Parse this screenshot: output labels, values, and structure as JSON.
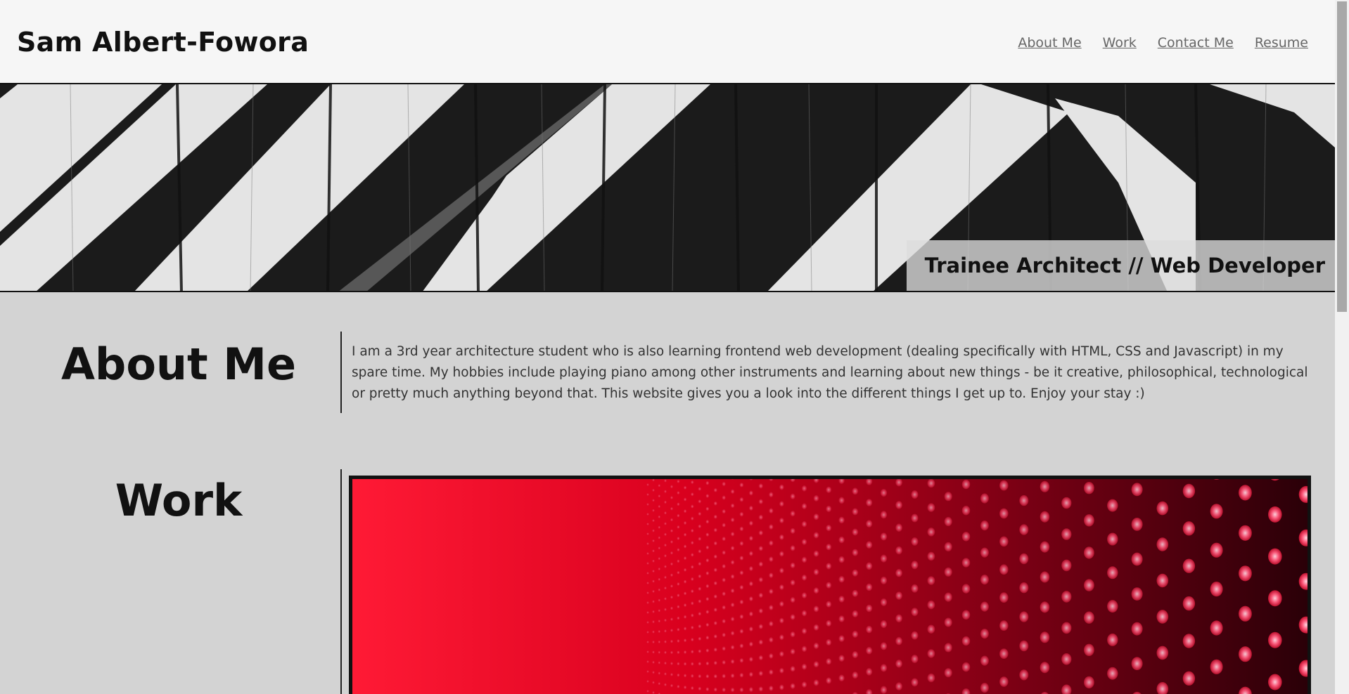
{
  "header": {
    "site_title": "Sam Albert-Fowora",
    "nav": [
      {
        "label": "About Me"
      },
      {
        "label": "Work"
      },
      {
        "label": "Contact Me"
      },
      {
        "label": "Resume"
      }
    ]
  },
  "hero": {
    "tagline": "Trainee Architect // Web Developer",
    "image": "black-white-striped-wooden-fence"
  },
  "about": {
    "heading": "About Me",
    "body": "I am a 3rd year architecture student who is also learning frontend web development (dealing specifically with HTML, CSS and Javascript) in my spare time. My hobbies include playing piano among other instruments and learning about new things - be it creative, philosophical, technological or pretty much anything beyond that. This website gives you a look into the different things I get up to. Enjoy your stay :)"
  },
  "work": {
    "heading": "Work",
    "image": "red-led-panel"
  },
  "colors": {
    "header_bg": "#f6f6f6",
    "page_bg": "#d3d3d3",
    "text": "#111111",
    "nav_link": "#666666",
    "led_red": "#e8102a"
  }
}
